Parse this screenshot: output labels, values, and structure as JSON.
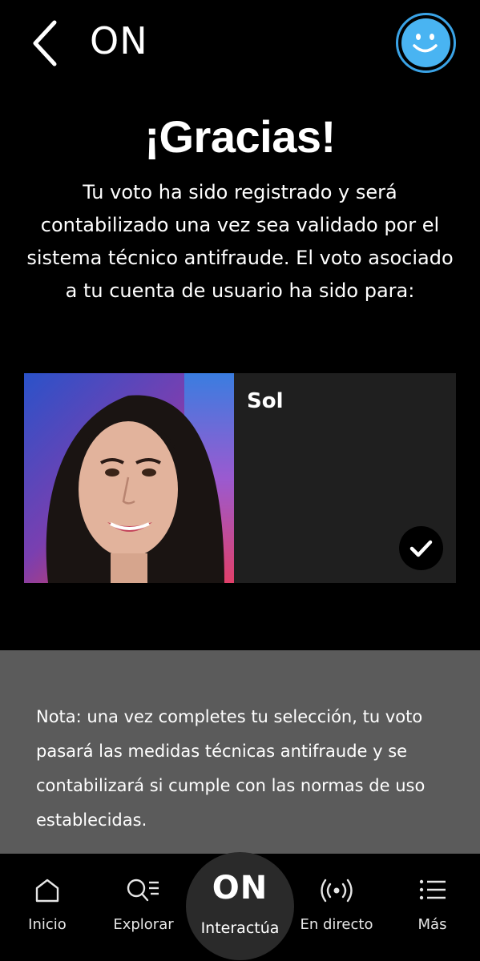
{
  "header": {
    "brand": "ON"
  },
  "main": {
    "title": "¡Gracias!",
    "message": "Tu voto ha sido registrado y será contabilizado una vez sea validado por el sistema técnico antifraude. El voto asociado a tu cuenta de usuario ha sido para:",
    "candidate": {
      "name": "Sol",
      "selected": true
    }
  },
  "note": {
    "text": "Nota: una vez completes tu selección, tu voto pasará las medidas técnicas antifraude y se contabilizará si cumple con las normas de uso establecidas."
  },
  "tabbar": {
    "items": [
      {
        "label": "Inicio",
        "icon": "home-icon"
      },
      {
        "label": "Explorar",
        "icon": "explore-icon"
      },
      {
        "label": "Interactúa",
        "icon": "on-logo-icon",
        "logo": "ON"
      },
      {
        "label": "En directo",
        "icon": "live-broadcast-icon"
      },
      {
        "label": "Más",
        "icon": "menu-list-icon"
      }
    ]
  },
  "colors": {
    "background": "#000000",
    "card": "#1f1f1f",
    "note_panel": "#5b5b5b",
    "avatar_accent": "#3aa3e6"
  }
}
